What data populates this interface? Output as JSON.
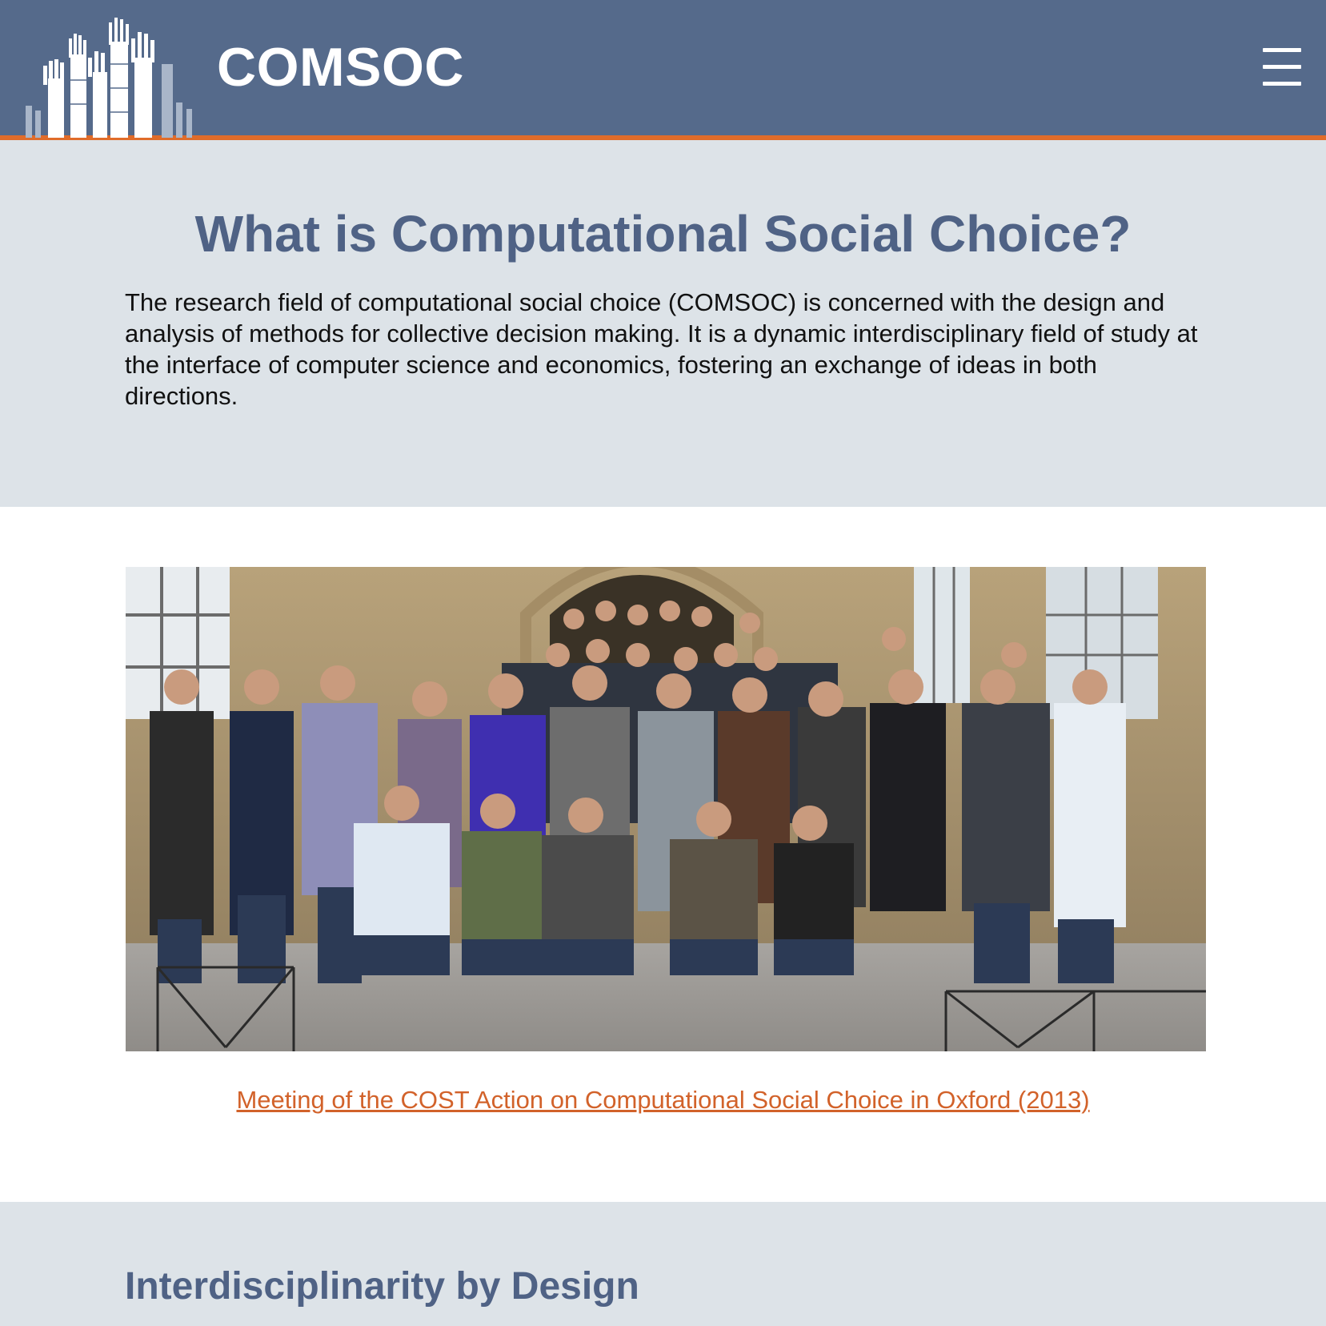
{
  "header": {
    "site_title": "COMSOC",
    "logo_icon": "raised-hands-logo",
    "menu_icon": "hamburger-menu-icon",
    "colors": {
      "background": "#556a8b",
      "accent_border": "#e06c2a"
    }
  },
  "intro": {
    "heading": "What is Computational Social Choice?",
    "paragraph": "The research field of computational social choice (COMSOC) is concerned with the design and analysis of methods for collective decision making. It is a dynamic interdisciplinary field of study at the interface of computer science and economics, fostering an exchange of ideas in both directions."
  },
  "photo_section": {
    "photo_description_icon": "group-photo",
    "caption_link": "Meeting of the COST Action on Computational Social Choice in Oxford (2013)",
    "link_color": "#d2622a"
  },
  "next_section": {
    "heading": "Interdisciplinarity by Design"
  }
}
